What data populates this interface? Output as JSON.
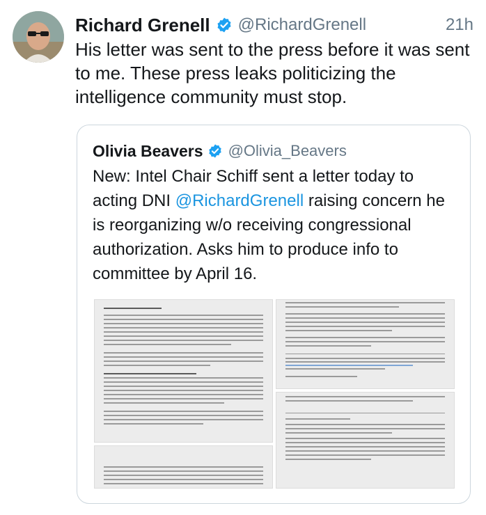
{
  "tweet": {
    "author_name": "Richard Grenell",
    "author_handle": "@RichardGrenell",
    "time": "21h",
    "text": "His letter was sent to the press before it was sent to me. These press leaks politicizing the intelligence community must stop.",
    "avatar_icon": "profile-photo",
    "verified_icon": "verified-badge-icon",
    "colors": {
      "verified": "#1da1f2",
      "secondary_text": "#657786"
    }
  },
  "quoted_tweet": {
    "author_name": "Olivia Beavers",
    "author_handle": "@Olivia_Beavers",
    "text_before_mention": "New: Intel Chair Schiff sent a letter today to acting DNI ",
    "mention": "@RichardGrenell",
    "text_after_mention": " raising concern he is reorganizing w/o receiving congressional authorization. Asks him to produce info to committee by April 16.",
    "media": [
      {
        "description_icon": "letter-page-image"
      },
      {
        "description_icon": "letter-page-image"
      },
      {
        "description_icon": "letter-page-image"
      },
      {
        "description_icon": "letter-page-image"
      }
    ],
    "colors": {
      "mention": "#1b95e0",
      "border": "#ccd6dd"
    }
  }
}
